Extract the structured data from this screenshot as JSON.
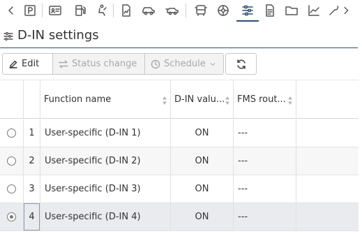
{
  "toolbar_icons": [
    {
      "name": "chevron-left-icon"
    },
    {
      "name": "parking-icon",
      "label": "P"
    },
    {
      "name": "id-card-icon"
    },
    {
      "name": "fuel-pump-icon"
    },
    {
      "name": "driver-seat-icon"
    },
    {
      "name": "document-chart-icon"
    },
    {
      "name": "vehicle-icon"
    },
    {
      "name": "vehicle-speed-icon"
    },
    {
      "name": "truck-front-icon"
    },
    {
      "name": "wheel-icon"
    },
    {
      "name": "sliders-icon"
    },
    {
      "name": "document-icon"
    },
    {
      "name": "folder-icon"
    },
    {
      "name": "trend-chart-icon"
    },
    {
      "name": "wrench-icon"
    },
    {
      "name": "chevron-right-icon"
    }
  ],
  "header": {
    "title": "D-IN settings"
  },
  "actions": {
    "edit": "Edit",
    "status_change": "Status change",
    "schedule": "Schedule"
  },
  "table": {
    "columns": [
      "Function name",
      "D-IN valu...",
      "FMS rout..."
    ],
    "rows": [
      {
        "num": "1",
        "name": "User-specific (D-IN 1)",
        "value": "ON",
        "fms": "---",
        "selected": false
      },
      {
        "num": "2",
        "name": "User-specific (D-IN 2)",
        "value": "ON",
        "fms": "---",
        "selected": false
      },
      {
        "num": "3",
        "name": "User-specific (D-IN 3)",
        "value": "ON",
        "fms": "---",
        "selected": false
      },
      {
        "num": "4",
        "name": "User-specific (D-IN 4)",
        "value": "ON",
        "fms": "---",
        "selected": true
      }
    ]
  },
  "colors": {
    "accent": "#2b4f6e",
    "selected_row": "#e9ebee",
    "alt_row": "#f7f7f7"
  }
}
